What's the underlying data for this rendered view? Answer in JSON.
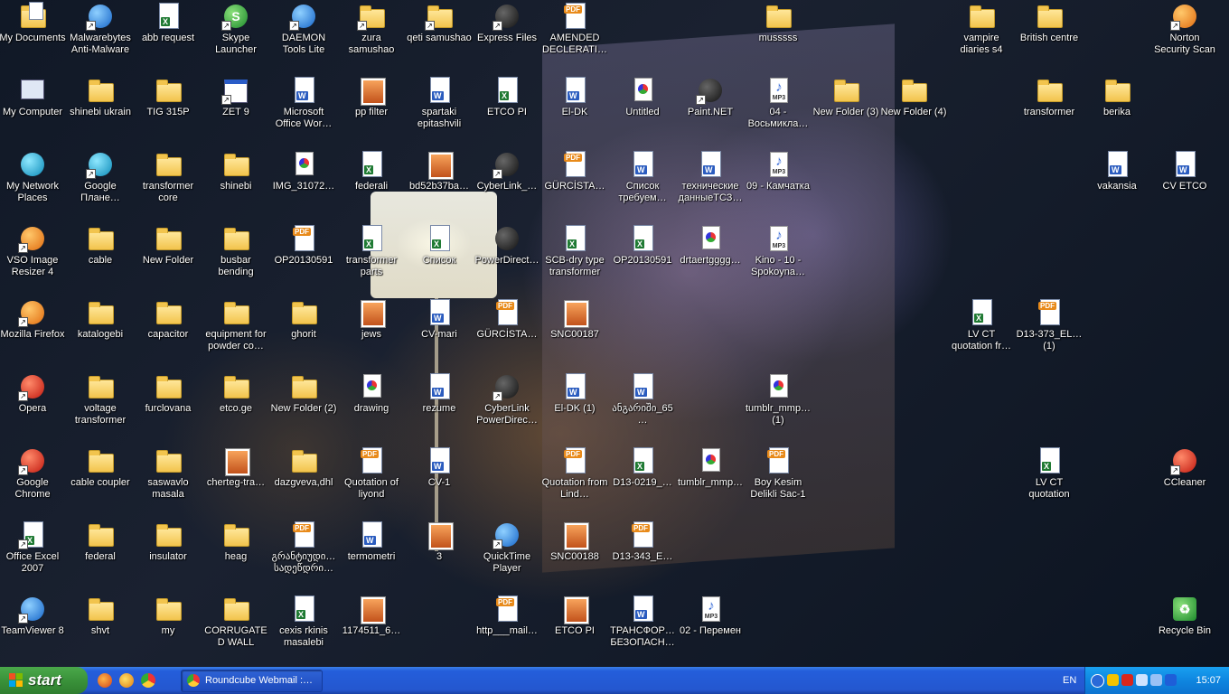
{
  "desktop": {
    "icons": [
      {
        "label": "My Documents",
        "type": "folder-docs"
      },
      {
        "label": "Malwarebytes Anti-Malware",
        "type": "app-blue",
        "shortcut": true
      },
      {
        "label": "abb request",
        "type": "excel"
      },
      {
        "label": "Skype Launcher",
        "type": "app-green",
        "shortcut": true
      },
      {
        "label": "DAEMON Tools Lite",
        "type": "app-blue",
        "shortcut": true
      },
      {
        "label": "zura samushao",
        "type": "folder",
        "shortcut": true
      },
      {
        "label": "qeti samushao",
        "type": "folder",
        "shortcut": true
      },
      {
        "label": "Express Files",
        "type": "app-dark",
        "shortcut": true
      },
      {
        "label": "AMENDED DECLERATI…",
        "type": "pdf"
      },
      {
        "label": "musssss",
        "type": "folder"
      },
      {
        "label": "vampire diaries s4",
        "type": "folder"
      },
      {
        "label": "British centre",
        "type": "folder"
      },
      {
        "label": "Norton Security Scan",
        "type": "app-orange",
        "shortcut": true
      },
      {
        "label": "My Computer",
        "type": "computer"
      },
      {
        "label": "shinebi ukrain",
        "type": "folder"
      },
      {
        "label": "TIG 315P",
        "type": "folder"
      },
      {
        "label": "ZET 9",
        "type": "window",
        "shortcut": true
      },
      {
        "label": "Microsoft Office Wor…",
        "type": "word"
      },
      {
        "label": "pp filter",
        "type": "jpg"
      },
      {
        "label": "spartaki epitashvili",
        "type": "word"
      },
      {
        "label": "ETCO PI",
        "type": "excel"
      },
      {
        "label": "El-DK",
        "type": "word"
      },
      {
        "label": "Untitled",
        "type": "picture"
      },
      {
        "label": "Paint.NET",
        "type": "app-dark",
        "shortcut": true
      },
      {
        "label": "04 - Восьмикла…",
        "type": "mp3"
      },
      {
        "label": "New Folder (3)",
        "type": "folder"
      },
      {
        "label": "New Folder (4)",
        "type": "folder"
      },
      {
        "label": "transformer",
        "type": "folder"
      },
      {
        "label": "berika",
        "type": "folder"
      },
      {
        "label": "My Network Places",
        "type": "network"
      },
      {
        "label": "Google Плане…",
        "type": "app-teal",
        "shortcut": true
      },
      {
        "label": "transformer core",
        "type": "folder"
      },
      {
        "label": "shinebi",
        "type": "folder"
      },
      {
        "label": "IMG_31072…",
        "type": "picture"
      },
      {
        "label": "federali",
        "type": "excel"
      },
      {
        "label": "bd52b37ba…",
        "type": "jpg"
      },
      {
        "label": "CyberLink_…",
        "type": "app-dark",
        "shortcut": true
      },
      {
        "label": "GÜRCİSTA…",
        "type": "pdf"
      },
      {
        "label": "Список требуем…",
        "type": "word"
      },
      {
        "label": "технические данныеТСЗ…",
        "type": "word"
      },
      {
        "label": "09 - Камчатка",
        "type": "mp3"
      },
      {
        "label": "vakansia",
        "type": "word"
      },
      {
        "label": "CV ETCO",
        "type": "word"
      },
      {
        "label": "VSO Image Resizer 4",
        "type": "app-orange",
        "shortcut": true
      },
      {
        "label": "cable",
        "type": "folder"
      },
      {
        "label": "New Folder",
        "type": "folder"
      },
      {
        "label": "busbar bending",
        "type": "folder"
      },
      {
        "label": "OP20130591",
        "type": "pdf"
      },
      {
        "label": "transformer parts",
        "type": "excel"
      },
      {
        "label": "Список",
        "type": "excel"
      },
      {
        "label": "PowerDirect…",
        "type": "app-dark"
      },
      {
        "label": "SCB-dry type transformer",
        "type": "excel"
      },
      {
        "label": "OP20130591",
        "type": "excel"
      },
      {
        "label": "drtaertgggg…",
        "type": "picture"
      },
      {
        "label": "Kino - 10 - Spokoyna…",
        "type": "mp3"
      },
      {
        "label": "Mozilla Firefox",
        "type": "app-orange",
        "shortcut": true
      },
      {
        "label": "katalogebi",
        "type": "folder"
      },
      {
        "label": "capacitor",
        "type": "folder"
      },
      {
        "label": "equipment for powder co…",
        "type": "folder"
      },
      {
        "label": "ghorit",
        "type": "folder"
      },
      {
        "label": "jews",
        "type": "jpg"
      },
      {
        "label": "CV-mari",
        "type": "word"
      },
      {
        "label": "GÜRCİSTA…",
        "type": "pdf"
      },
      {
        "label": "SNC00187",
        "type": "jpg"
      },
      {
        "label": "LV CT quotation fr…",
        "type": "excel"
      },
      {
        "label": "D13-373_EL… (1)",
        "type": "pdf"
      },
      {
        "label": "Opera",
        "type": "app-red",
        "shortcut": true
      },
      {
        "label": "voltage transformer",
        "type": "folder"
      },
      {
        "label": "furclovana",
        "type": "folder"
      },
      {
        "label": "etco.ge",
        "type": "folder"
      },
      {
        "label": "New Folder (2)",
        "type": "folder"
      },
      {
        "label": "drawing",
        "type": "picture"
      },
      {
        "label": "rezume",
        "type": "word"
      },
      {
        "label": "CyberLink PowerDirec…",
        "type": "app-dark",
        "shortcut": true
      },
      {
        "label": "El-DK (1)",
        "type": "word"
      },
      {
        "label": "ანგარიში_65…",
        "type": "word"
      },
      {
        "label": "tumblr_mmp… (1)",
        "type": "picture"
      },
      {
        "label": "Google Chrome",
        "type": "app-red",
        "shortcut": true
      },
      {
        "label": "cable coupler",
        "type": "folder"
      },
      {
        "label": "saswavlo masala",
        "type": "folder"
      },
      {
        "label": "cherteg-tra…",
        "type": "jpg"
      },
      {
        "label": "dazgveva,dhl",
        "type": "folder"
      },
      {
        "label": "Quotation of liyond",
        "type": "pdf"
      },
      {
        "label": "CV-1",
        "type": "word"
      },
      {
        "label": "Quotation from Lind…",
        "type": "pdf"
      },
      {
        "label": "D13-0219_…",
        "type": "excel"
      },
      {
        "label": "tumblr_mmp…",
        "type": "picture"
      },
      {
        "label": "Boy Kesim Delikli Sac-1",
        "type": "pdf"
      },
      {
        "label": "LV CT quotation",
        "type": "excel"
      },
      {
        "label": "CCleaner",
        "type": "app-red",
        "shortcut": true
      },
      {
        "label": "Office Excel 2007",
        "type": "excel",
        "shortcut": true
      },
      {
        "label": "federal",
        "type": "folder"
      },
      {
        "label": "insulator",
        "type": "folder"
      },
      {
        "label": "heag",
        "type": "folder"
      },
      {
        "label": "გრანტიუდი… სადეწდრი…",
        "type": "pdf"
      },
      {
        "label": "termometri",
        "type": "word"
      },
      {
        "label": "3",
        "type": "jpg"
      },
      {
        "label": "QuickTime Player",
        "type": "app-blue",
        "shortcut": true
      },
      {
        "label": "SNC00188",
        "type": "jpg"
      },
      {
        "label": "D13-343_E…",
        "type": "pdf"
      },
      {
        "label": "TeamViewer 8",
        "type": "app-blue",
        "shortcut": true
      },
      {
        "label": "shvt",
        "type": "folder"
      },
      {
        "label": "my",
        "type": "folder"
      },
      {
        "label": "CORRUGATED WALL",
        "type": "folder"
      },
      {
        "label": "cexis rkinis masalebi",
        "type": "excel"
      },
      {
        "label": "1174511_6…",
        "type": "jpg"
      },
      {
        "label": "http___mail…",
        "type": "pdf"
      },
      {
        "label": "ETCO PI",
        "type": "jpg"
      },
      {
        "label": "ТРАНСФОР… БЕЗОПАСН…",
        "type": "word"
      },
      {
        "label": "02 - Перемен",
        "type": "mp3"
      },
      {
        "label": "Recycle Bin",
        "type": "recycle"
      }
    ]
  },
  "taskbar": {
    "start_label": "start",
    "quick_launch": [
      "firefox-icon",
      "messenger-icon",
      "chrome-icon"
    ],
    "tasks": [
      {
        "label": "Roundcube Webmail :…"
      }
    ],
    "language": "EN",
    "tray_icons": [
      "back-arrow-icon",
      "antivirus-icon",
      "security-icon",
      "network-icon",
      "volume-icon",
      "malwarebytes-icon"
    ],
    "clock": "15:07"
  }
}
